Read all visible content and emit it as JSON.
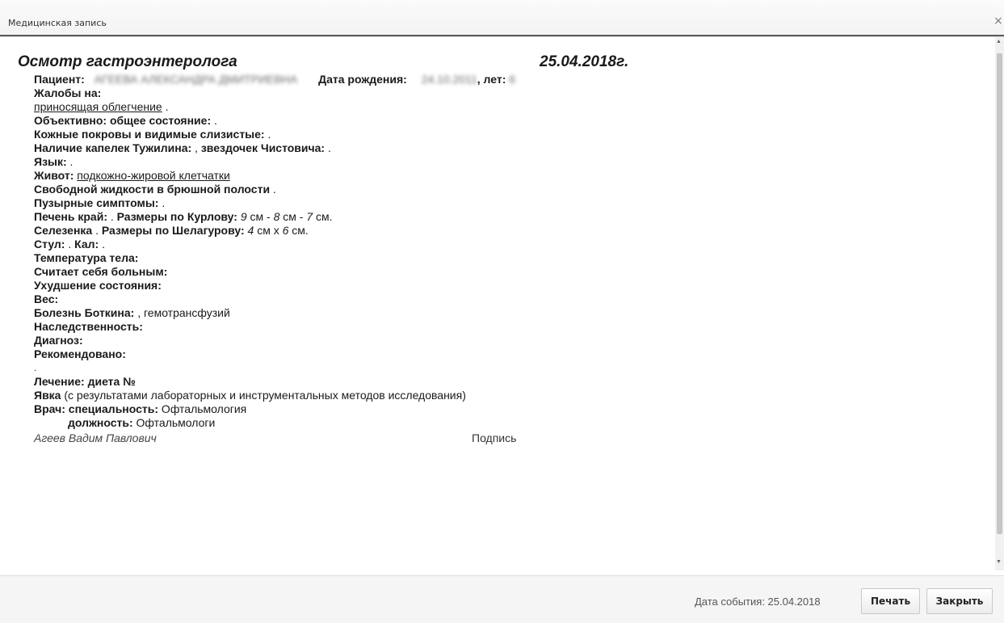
{
  "window": {
    "title": "Медицинская запись",
    "close_glyph": "×"
  },
  "doc": {
    "heading": "Осмотр гастроэнтеролога",
    "date": "25.04.2018г.",
    "patient_label": "Пациент:",
    "patient_name": "АГЕЕВА АЛЕКСАНДРА ДМИТРИЕВНА",
    "dob_label": "Дата рождения:",
    "dob_value": "24.10.2011",
    "age_label": ", лет:",
    "age_value": "6",
    "complaints_label": "Жалобы на:",
    "complaints_value": "приносящая облегчение",
    "complaints_tail": " .",
    "objective": "Объективно:  общее состояние:",
    "dot": " .",
    "skin": "Кожные покровы и видимые слизистые:",
    "drops_label": "Наличие  капелек Тужилина:",
    "drops_mid": " , ",
    "stars_label": "звездочек Чистовича:",
    "tongue": "Язык:",
    "abdomen_label": "Живот:",
    "abdomen_value": "подкожно-жировой клетчатки",
    "fluid": "Свободной жидкости в брюшной полости",
    "bladder": "Пузырные симптомы:",
    "liver_label": "Печень  край:",
    "liver_mid": " . ",
    "kurlov_label": "Размеры по Курлову:",
    "kurlov_v1": "9",
    "kurlov_u1": " см - ",
    "kurlov_v2": "8",
    "kurlov_u2": " см - ",
    "kurlov_v3": "7",
    "kurlov_u3": " см.",
    "spleen_label": "Селезенка",
    "spleen_mid": " . ",
    "shelagurov_label": "Размеры по Шелагурову:",
    "sh_v1": "4",
    "sh_u1": " см х ",
    "sh_v2": "6",
    "sh_u2": " см.",
    "stool_label": "Стул:",
    "stool_mid": "   . ",
    "feces_label": "Кал:",
    "temperature": "Температура тела:",
    "considers_ill": "Считает себя больным:",
    "worsening": "Ухудшение состояния:",
    "weight": "Вес:",
    "botkin_label": "Болезнь Боткина:",
    "botkin_value": " , гемотрансфузий",
    "heredity": "Наследственность:",
    "diagnosis": "Диагноз:",
    "recommended": "Рекомендовано:",
    "lone_dot": ".",
    "treatment": "Лечение: диета №",
    "visit_label": "Явка",
    "visit_value": "   (с результатами лабораторных и инструментальных методов исследования)",
    "doctor_label": "Врач:",
    "specialty_label": " специальность:",
    "specialty_value": " Офтальмология",
    "position_label": "должность:",
    "position_value": " Офтальмологи",
    "doctor_name": "Агеев Вадим Павлович",
    "signature": "Подпись"
  },
  "footer": {
    "event_date": "Дата события: 25.04.2018",
    "print_label": "Печать",
    "close_label": "Закрыть"
  },
  "scrollbar": {
    "up_glyph": "▲",
    "down_glyph": "▼"
  }
}
